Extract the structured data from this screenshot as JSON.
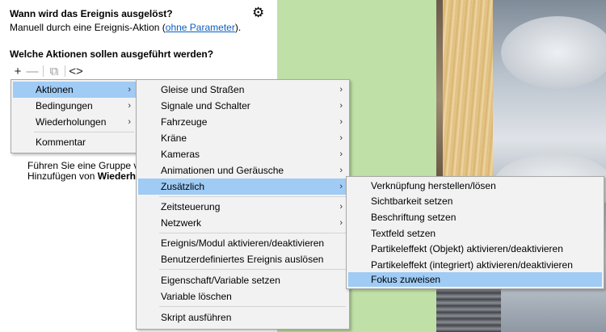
{
  "trigger": {
    "question": "Wann wird das Ereignis ausgelöst?",
    "text_before": "Manuell durch eine Ereignis-Aktion (",
    "link": "ohne Parameter",
    "text_after": ")."
  },
  "actions_question": "Welche Aktionen sollen ausgeführt werden?",
  "toolbar": {
    "add": "+",
    "remove": "—",
    "copy": "⧉",
    "code": "<>"
  },
  "hint": {
    "line1": "Führen Sie eine Gruppe von",
    "line2_prefix": "Hinzufügen von ",
    "line2_bold": "Wiederhol"
  },
  "menu1": {
    "items": [
      {
        "label": "Aktionen",
        "submenu": true,
        "highlighted": true
      },
      {
        "label": "Bedingungen",
        "submenu": true
      },
      {
        "label": "Wiederholungen",
        "submenu": true
      },
      {
        "label": "Kommentar",
        "submenu": false
      }
    ]
  },
  "menu2": {
    "items": [
      {
        "label": "Gleise und Straßen",
        "submenu": true
      },
      {
        "label": "Signale und Schalter",
        "submenu": true
      },
      {
        "label": "Fahrzeuge",
        "submenu": true
      },
      {
        "label": "Kräne",
        "submenu": true
      },
      {
        "label": "Kameras",
        "submenu": true
      },
      {
        "label": "Animationen und Geräusche",
        "submenu": true
      },
      {
        "label": "Zusätzlich",
        "submenu": true,
        "highlighted": true
      },
      {
        "label": "Zeitsteuerung",
        "submenu": true
      },
      {
        "label": "Netzwerk",
        "submenu": true
      },
      {
        "label": "Ereignis/Modul aktivieren/deaktivieren",
        "submenu": false
      },
      {
        "label": "Benutzerdefiniertes Ereignis auslösen",
        "submenu": false
      },
      {
        "label": "Eigenschaft/Variable setzen",
        "submenu": false
      },
      {
        "label": "Variable löschen",
        "submenu": false
      },
      {
        "label": "Skript ausführen",
        "submenu": false
      }
    ]
  },
  "menu3": {
    "items": [
      {
        "label": "Verknüpfung herstellen/lösen"
      },
      {
        "label": "Sichtbarkeit setzen"
      },
      {
        "label": "Beschriftung setzen"
      },
      {
        "label": "Textfeld setzen"
      },
      {
        "label": "Partikeleffekt (Objekt) aktivieren/deaktivieren"
      },
      {
        "label": "Partikeleffekt (integriert) aktivieren/deaktivieren"
      },
      {
        "label": "Fokus zuweisen",
        "highlighted": true
      }
    ]
  },
  "colors": {
    "highlight": "#9fcbf5",
    "link": "#0a5fbf",
    "green_area": "#bfe0a6",
    "menu_bg": "#f2f2f2"
  },
  "icons": {
    "settings": "gear-icon",
    "submenu": "chevron-right-icon"
  }
}
